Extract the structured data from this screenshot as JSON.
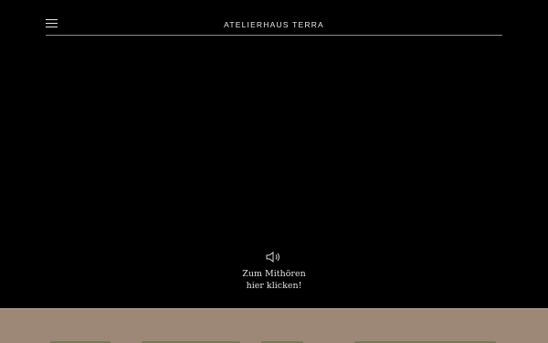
{
  "header": {
    "site_title": "ATELIERHAUS TERRA",
    "menu_icon": "hamburger-menu-icon"
  },
  "video": {
    "unmute_icon": "speaker-icon",
    "unmute_line1": "Zum Mithören",
    "unmute_line2": "hier klicken!"
  },
  "colors": {
    "background": "#000000",
    "band": "#9d8877",
    "text": "#e0e0e0",
    "divider": "#8c8c8c",
    "peek_text": "#6d7550"
  }
}
